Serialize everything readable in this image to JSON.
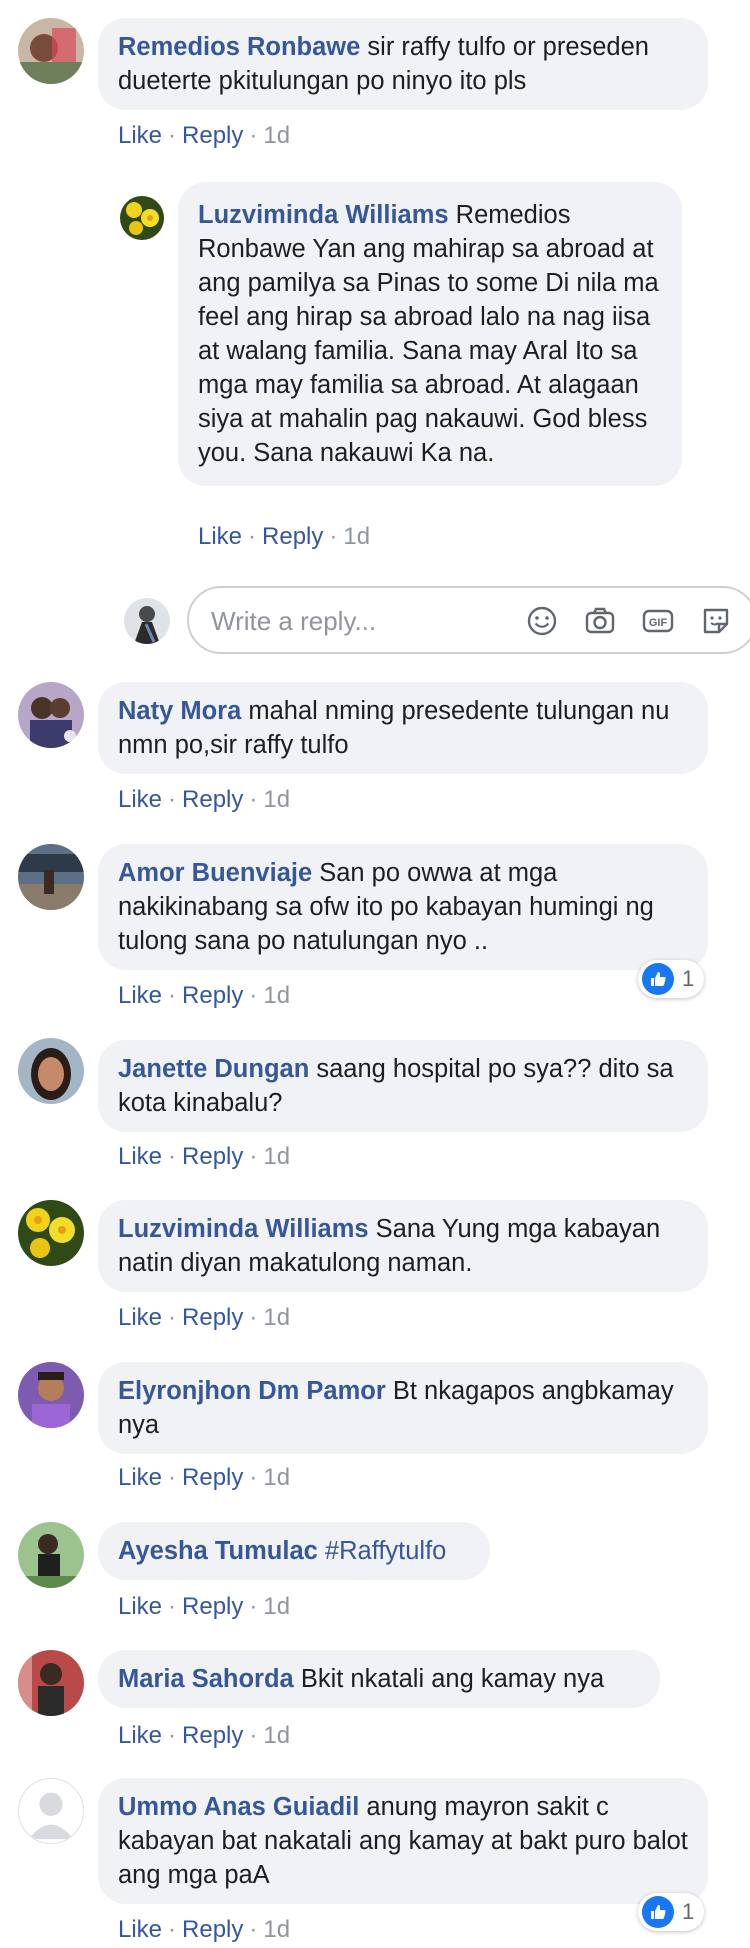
{
  "comments": [
    {
      "author": "Remedios Ronbawe",
      "text": " sir raffy tulfo or preseden dueterte pkitulungan po ninyo ito pls",
      "avatar_icon": "photo-avatar"
    },
    {
      "author": "Luzviminda Williams",
      "text": " Remedios Ronbawe Yan ang mahirap sa abroad at ang pamilya sa Pinas to some Di nila ma feel ang hirap sa abroad lalo na nag iisa at walang familia. Sana may Aral Ito sa mga may familia sa abroad. At alagaan siya at mahalin pag nakauwi. God bless you. Sana nakauwi Ka na.",
      "avatar_icon": "daffodil-avatar"
    },
    {
      "author": "Naty Mora",
      "text": " mahal nming presedente tulungan nu nmn po,sir raffy tulfo",
      "avatar_icon": "photo-avatar"
    },
    {
      "author": "Amor Buenviaje",
      "text": " San po owwa at mga nakikinabang sa ofw ito po kabayan humingi ng tulong sana po natulungan nyo ..",
      "avatar_icon": "photo-avatar",
      "reaction_count": "1"
    },
    {
      "author": "Janette Dungan",
      "text": " saang hospital po sya?? dito sa kota kinabalu?",
      "avatar_icon": "photo-avatar"
    },
    {
      "author": "Luzviminda Williams",
      "text": " Sana Yung mga kabayan natin diyan makatulong naman.",
      "avatar_icon": "daffodil-avatar"
    },
    {
      "author": "Elyronjhon Dm Pamor",
      "text": " Bt nkagapos angbkamay nya",
      "avatar_icon": "photo-avatar"
    },
    {
      "author": "Ayesha Tumulac",
      "text": " #Raffytulfo",
      "avatar_icon": "photo-avatar"
    },
    {
      "author": "Maria Sahorda",
      "text": " Bkit nkatali ang kamay nya",
      "avatar_icon": "photo-avatar"
    },
    {
      "author": "Ummo Anas Guiadil",
      "text": " anung mayron sakit c kabayan bat nakatali ang kamay at bakt puro balot ang mga paA",
      "avatar_icon": "default-avatar",
      "reaction_count": "1"
    }
  ],
  "actions": {
    "like": "Like",
    "reply": "Reply",
    "time": "1d",
    "sep": "·"
  },
  "reply_box": {
    "placeholder": "Write a reply...",
    "tools": [
      "emoji-icon",
      "camera-icon",
      "gif-icon",
      "sticker-icon"
    ]
  },
  "colors": {
    "author": "#365899",
    "bubble": "#f0f2f5",
    "like_blue": "#1877f2",
    "meta": "#90949c"
  }
}
